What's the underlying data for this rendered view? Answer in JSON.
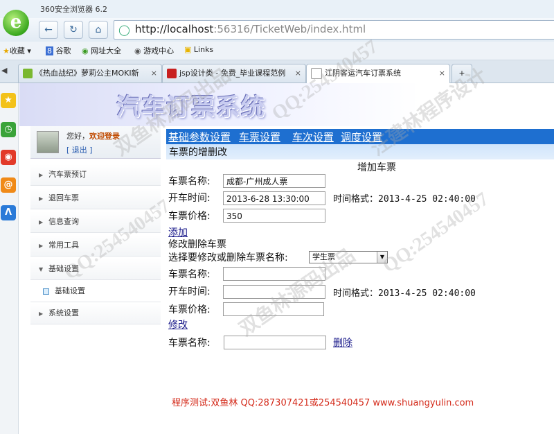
{
  "browser": {
    "window_title": "360安全浏览器 6.2",
    "url_host": "http://localhost",
    "url_rest": ":56316/TicketWeb/index.html",
    "bookmarks": [
      "收藏",
      "谷歌",
      "网址大全",
      "游戏中心",
      "Links"
    ],
    "tabs": [
      {
        "title": "《热血战纪》萝莉公主MOKI新",
        "close": "×"
      },
      {
        "title": "jsp设计类 - 免费_毕业课程范例",
        "close": "×"
      },
      {
        "title": "江阴客运汽车订票系统",
        "close": "×"
      }
    ],
    "new_tab": "+"
  },
  "banner": {
    "title": "汽车订票系统"
  },
  "user": {
    "greeting_prefix": "您好，",
    "greeting_action": "欢迎登录",
    "logout": "[ 退出 ]"
  },
  "sidebar": {
    "items": [
      {
        "label": "汽车票预订"
      },
      {
        "label": "退回车票"
      },
      {
        "label": "信息查询"
      },
      {
        "label": "常用工具"
      },
      {
        "label": "基础设置"
      },
      {
        "label": "基础设置"
      },
      {
        "label": "系统设置"
      }
    ]
  },
  "nav": {
    "links": [
      "基础参数设置",
      "车票设置",
      "车次设置",
      "调度设置"
    ],
    "sub_title": "车票的增删改"
  },
  "add_form": {
    "heading": "增加车票",
    "name_label": "车票名称:",
    "name_value": "成都-广州成人票",
    "time_label": "开车时间:",
    "time_value": "2013-6-28 13:30:00",
    "time_hint": "时间格式：2013-4-25 02:40:00",
    "price_label": "车票价格:",
    "price_value": "350",
    "submit": "添加"
  },
  "edit_form": {
    "heading": "修改删除车票",
    "select_label": "选择要修改或删除车票名称:",
    "select_value": "学生票",
    "name_label": "车票名称:",
    "name_value": "",
    "time_label": "开车时间:",
    "time_value": "",
    "time_hint": "时间格式：2013-4-25 02:40:00",
    "price_label": "车票价格:",
    "price_value": "",
    "submit": "修改"
  },
  "delete_form": {
    "name_label": "车票名称:",
    "name_value": "",
    "submit": "删除"
  },
  "footer": "程序测试:双鱼林 QQ:287307421或254540457 www.shuangyulin.com",
  "watermarks": [
    "QQ:254540457",
    "双鱼林源码出品",
    "汪建林程序设计",
    "QQ:254540457",
    "双鱼林源码出品",
    "QQ:254540457"
  ],
  "colors": {
    "nav_bar": "#1e6fd0",
    "footer_text": "#d42a1a",
    "link": "#1a1a8a"
  }
}
